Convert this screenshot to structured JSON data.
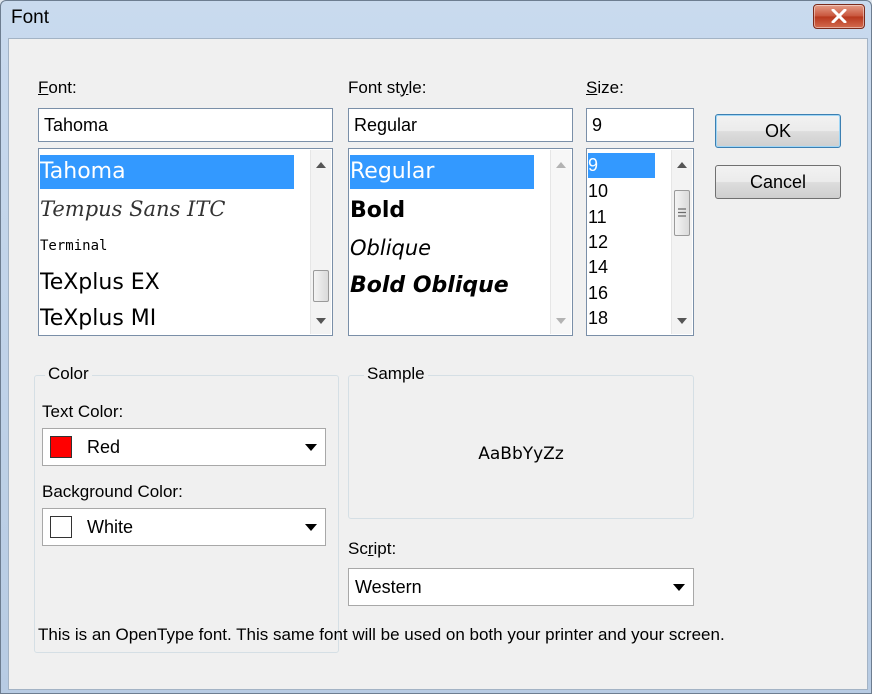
{
  "window": {
    "title": "Font"
  },
  "font_panel": {
    "label": "Font:",
    "label_accel": "F",
    "label_rest": "ont:",
    "value": "Tahoma",
    "items": [
      "Tahoma",
      "Tempus Sans ITC",
      "Terminal",
      "TeXplus EX",
      "TeXplus MI"
    ],
    "selected_index": 0
  },
  "style_panel": {
    "label_pre": "Font st",
    "label_accel": "y",
    "label_post": "le:",
    "value": "Regular",
    "items": [
      "Regular",
      "Bold",
      "Oblique",
      "Bold Oblique"
    ],
    "selected_index": 0
  },
  "size_panel": {
    "label_accel": "S",
    "label_rest": "ize:",
    "value": "9",
    "items": [
      "9",
      "10",
      "11",
      "12",
      "14",
      "16",
      "18"
    ],
    "selected_index": 0
  },
  "buttons": {
    "ok": "OK",
    "cancel": "Cancel"
  },
  "color_group": {
    "title": "Color",
    "text_color_label": "Text Color:",
    "text_color_value": "Red",
    "text_color_hex": "#ff0000",
    "background_color_label": "Background Color:",
    "background_color_value": "White",
    "background_color_hex": "#ffffff"
  },
  "sample_group": {
    "title": "Sample",
    "sample_text": "AaBbYyZz"
  },
  "script": {
    "label_pre": "Sc",
    "label_accel": "r",
    "label_post": "ipt:",
    "value": "Western"
  },
  "description": "This is an OpenType font. This same font will be used on both your printer and your screen.",
  "colors": {
    "selection": "#3399ff",
    "close_button": "#c7533a"
  }
}
